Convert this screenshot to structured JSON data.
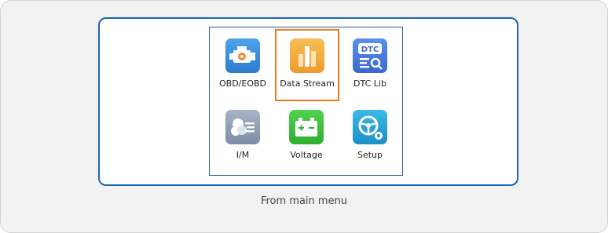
{
  "caption": "From main menu",
  "menu": {
    "items": [
      {
        "label": "OBD/EOBD",
        "icon": "engine-icon",
        "color": "#3a8fd9",
        "selected": false
      },
      {
        "label": "Data Stream",
        "icon": "bar-chart-icon",
        "color": "#f2a73a",
        "selected": true
      },
      {
        "label": "DTC Lib",
        "icon": "dtc-search-icon",
        "color": "#4a7ee0",
        "selected": false
      },
      {
        "label": "I/M",
        "icon": "im-readiness-icon",
        "color": "#8c9bb3",
        "selected": false
      },
      {
        "label": "Voltage",
        "icon": "battery-icon",
        "color": "#3cc43c",
        "selected": false
      },
      {
        "label": "Setup",
        "icon": "steering-gear-icon",
        "color": "#2aa6d8",
        "selected": false
      }
    ],
    "dtc_icon_text": "DTC"
  },
  "colors": {
    "selection_border": "#e97b1e",
    "panel_border": "#1b65b8"
  }
}
